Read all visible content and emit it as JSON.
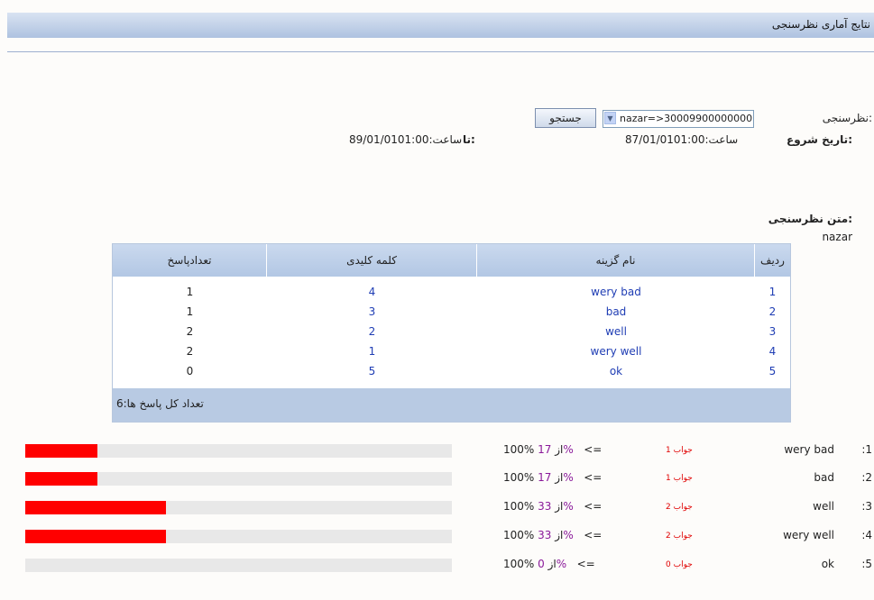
{
  "header": {
    "title": "نتایج آماری نظرسنجی"
  },
  "search": {
    "label": "نظرسنجی:",
    "selected": "nazar=>30009900000000",
    "button": "جستجو"
  },
  "dates": {
    "start_label": "تاریخ شروع:",
    "start_value": "87/01/01ساعت:01:00",
    "end_label": "تا:",
    "end_value": "89/01/01ساعت:01:00"
  },
  "poll": {
    "text_label": "متن نظرسنجی:",
    "text_value": "nazar"
  },
  "table": {
    "headers": {
      "row": "ردیف",
      "option": "نام گزینه",
      "keyword": "کلمه کلیدی",
      "count": "تعدادپاسخ"
    },
    "rows": [
      {
        "row": "1",
        "option": "wery bad",
        "keyword": "4",
        "count": "1"
      },
      {
        "row": "2",
        "option": "bad",
        "keyword": "3",
        "count": "1"
      },
      {
        "row": "3",
        "option": "well",
        "keyword": "2",
        "count": "2"
      },
      {
        "row": "4",
        "option": "wery well",
        "keyword": "1",
        "count": "2"
      },
      {
        "row": "5",
        "option": "ok",
        "keyword": "5",
        "count": "0"
      }
    ],
    "total": "تعداد کل پاسخ ها:6"
  },
  "results": [
    {
      "num": ":1",
      "name": "wery bad",
      "answers": "1 جواب",
      "percent": "17%",
      "fraction": 0.17
    },
    {
      "num": ":2",
      "name": "bad",
      "answers": "1 جواب",
      "percent": "17%",
      "fraction": 0.17
    },
    {
      "num": ":3",
      "name": "well",
      "answers": "2 جواب",
      "percent": "33%",
      "fraction": 0.33
    },
    {
      "num": ":4",
      "name": "wery well",
      "answers": "2 جواب",
      "percent": "33%",
      "fraction": 0.33
    },
    {
      "num": ":5",
      "name": "ok",
      "answers": "0 جواب",
      "percent": "0%",
      "fraction": 0
    }
  ],
  "result_text": {
    "arrow": "<=",
    "of": "از",
    "full": "100%"
  },
  "colors": {
    "bar": "#ff0000",
    "track": "#e8e8e8",
    "link": "#1f3db4"
  }
}
